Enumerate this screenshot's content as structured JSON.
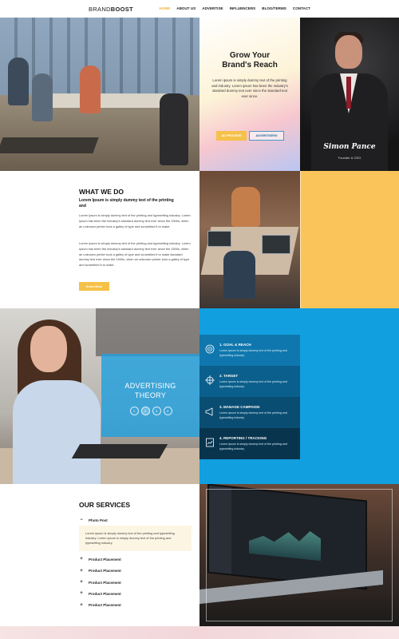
{
  "header": {
    "brand_light": "BRAND",
    "brand_bold": "BOOST",
    "nav": [
      "HOME",
      "ABOUT US",
      "ADVERTISE",
      "INFLUENCERS",
      "BLOG/TERMS",
      "CONTACT"
    ]
  },
  "hero": {
    "title_line1": "Grow Your",
    "title_line2": "Brand's Reach",
    "text": "Lorem ipsum is simply dummy text of the printing and industry. Lorem ipsum has been the industry's standard dummy text ever since the standard text ever since.",
    "btn_process": "AD PROCESS",
    "btn_advertisers": "ADVERTISERS",
    "person_name": "Simon Pance",
    "person_role": "Founder & CEO"
  },
  "what_we_do": {
    "title": "WHAT WE DO",
    "subtitle": "Lorem Ipsum is simply dummy text of the printing and",
    "para1": "Lorem Ipsum is simply dummy text of the printing and typesetting industry. Lorem Ipsum has been the industry's standard dummy text ever since the 1500s, when an unknown printer took a galley of type and scrambled it to make.",
    "para2": "Lorem Ipsum is simply dummy text of the printing and typesetting industry. Lorem Ipsum has been the industry's standard dummy text ever since the 1500s, when an unknown printer took a galley of type and scrambled it to make standard dummy text ever since the 1500s, when an unknown printer took a galley of type and scrambled it to make.",
    "button": "Know More"
  },
  "advertising": {
    "title_line1": "ADVERTISING",
    "title_line2": "THEORY",
    "dots": [
      "1",
      "2",
      "3",
      "4"
    ],
    "steps": [
      {
        "heading": "1. GOAL & REACH",
        "desc": "Lorem ipsum is simply dummy text of the printing and typesetting industry."
      },
      {
        "heading": "2. TARGET",
        "desc": "Lorem ipsum is simply dummy text of the printing and typesetting industry."
      },
      {
        "heading": "3. MANAGE CAMPAIGN",
        "desc": "Lorem ipsum is simply dummy text of the printing and typesetting industry."
      },
      {
        "heading": "4. REPORTING / TRACKING",
        "desc": "Lorem ipsum is simply dummy text of the printing and typesetting industry."
      }
    ],
    "step_colors": [
      "#0f77ad",
      "#0b5f8c",
      "#0a4d72",
      "#08344e"
    ]
  },
  "services": {
    "title": "OUR SERVICES",
    "open_item": "Photo Post",
    "open_text": "Lorem ipsum is simply dummy text of the printing and typesetting industry. Lorem ipsum is simply dummy text of the printing and typesetting industry.",
    "items": [
      "Product Placement",
      "Product Placement",
      "Product Placement",
      "Product Placement",
      "Product Placement"
    ]
  },
  "colors": {
    "accent_yellow": "#f5c148",
    "accent_blue": "#129fdf"
  }
}
